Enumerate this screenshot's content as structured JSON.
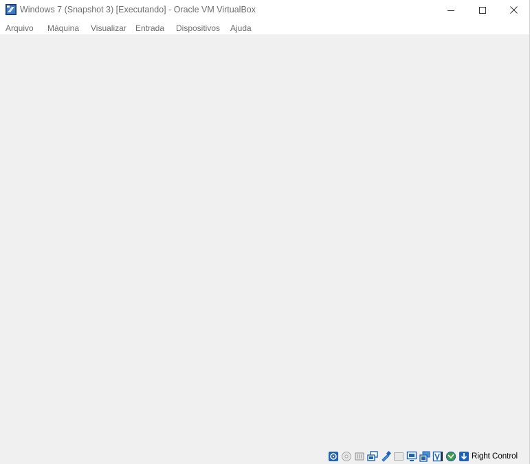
{
  "window": {
    "title": "Windows 7 (Snapshot 3) [Executando] - Oracle VM VirtualBox",
    "app_icon": "virtualbox-icon",
    "controls": [
      "minimize-icon",
      "maximize-icon",
      "close-icon"
    ]
  },
  "menu": {
    "items": [
      {
        "label": "Arquivo"
      },
      {
        "label": "Máquina"
      },
      {
        "label": "Visualizar"
      },
      {
        "label": "Entrada"
      },
      {
        "label": "Dispositivos"
      },
      {
        "label": "Ajuda"
      }
    ]
  },
  "statusbar": {
    "icons": [
      "hard-disk-icon",
      "optical-drive-icon",
      "audio-icon",
      "network-icon",
      "usb-icon",
      "shared-folders-icon",
      "display-icon",
      "recording-icon",
      "virtualization-icon",
      "mouse-integration-icon",
      "keyboard-capture-icon"
    ],
    "host_key": "Right Control"
  },
  "colors": {
    "display_background": "#f0f0f0",
    "title_text": "#6d6d6d",
    "icon_blue": "#1e63b4"
  }
}
